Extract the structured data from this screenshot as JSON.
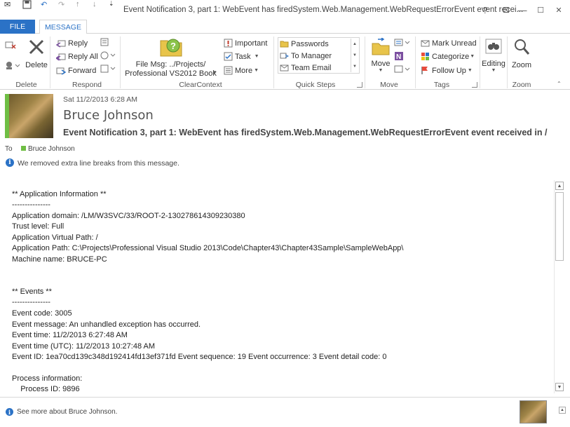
{
  "window": {
    "title": "Event Notification 3, part 1: WebEvent has firedSystem.Web.Management.WebRequestErrorEvent event recei...",
    "controls": {
      "help": "?",
      "restore_ribbon": "⊡",
      "minimize": "—",
      "maximize": "☐",
      "close": "✕"
    }
  },
  "tabs": {
    "file": "FILE",
    "message": "MESSAGE"
  },
  "ribbon": {
    "delete_group": {
      "label": "Delete",
      "delete_button": "Delete"
    },
    "respond_group": {
      "label": "Respond",
      "reply": "Reply",
      "reply_all": "Reply All",
      "forward": "Forward"
    },
    "clearcontext_group": {
      "label": "ClearContext",
      "file_msg_line1": "File Msg: ../Projects/",
      "file_msg_line2": "Professional VS2012 Book",
      "important": "Important",
      "task": "Task",
      "more": "More"
    },
    "quicksteps_group": {
      "label": "Quick Steps",
      "items": [
        "Passwords",
        "To Manager",
        "Team Email"
      ]
    },
    "move_group": {
      "label": "Move",
      "move_button": "Move"
    },
    "tags_group": {
      "label": "Tags",
      "mark_unread": "Mark Unread",
      "categorize": "Categorize",
      "follow_up": "Follow Up"
    },
    "editing_group": {
      "editing": "Editing"
    },
    "zoom_group": {
      "label": "Zoom",
      "zoom_button": "Zoom"
    }
  },
  "message": {
    "date": "Sat 11/2/2013 6:28 AM",
    "sender": "Bruce Johnson",
    "subject": "Event Notification 3, part 1: WebEvent has firedSystem.Web.Management.WebRequestErrorEvent event received in /",
    "to_label": "To",
    "to_name": "Bruce Johnson",
    "info_notice": "We removed extra line breaks from this message.",
    "body_lines": [
      "** Application Information **",
      "---------------",
      "Application domain: /LM/W3SVC/33/ROOT-2-130278614309230380",
      "Trust level: Full",
      "Application Virtual Path: /",
      "Application Path: C:\\Projects\\Professional Visual Studio 2013\\Code\\Chapter43\\Chapter43Sample\\SampleWebApp\\",
      "Machine name: BRUCE-PC",
      "",
      "",
      "** Events **",
      "---------------",
      "Event code: 3005",
      "Event message: An unhandled exception has occurred.",
      "Event time: 11/2/2013 6:27:48 AM",
      "Event time (UTC): 11/2/2013 10:27:48 AM",
      "Event ID: 1ea70cd139c348d192414fd13ef371fd Event sequence: 19 Event occurrence: 3 Event detail code: 0",
      "",
      "Process information:",
      "    Process ID: 9896"
    ]
  },
  "people_pane": {
    "text": "See more about Bruce Johnson."
  },
  "colors": {
    "accent": "#2b72c6",
    "contact_green": "#6fbe44"
  }
}
